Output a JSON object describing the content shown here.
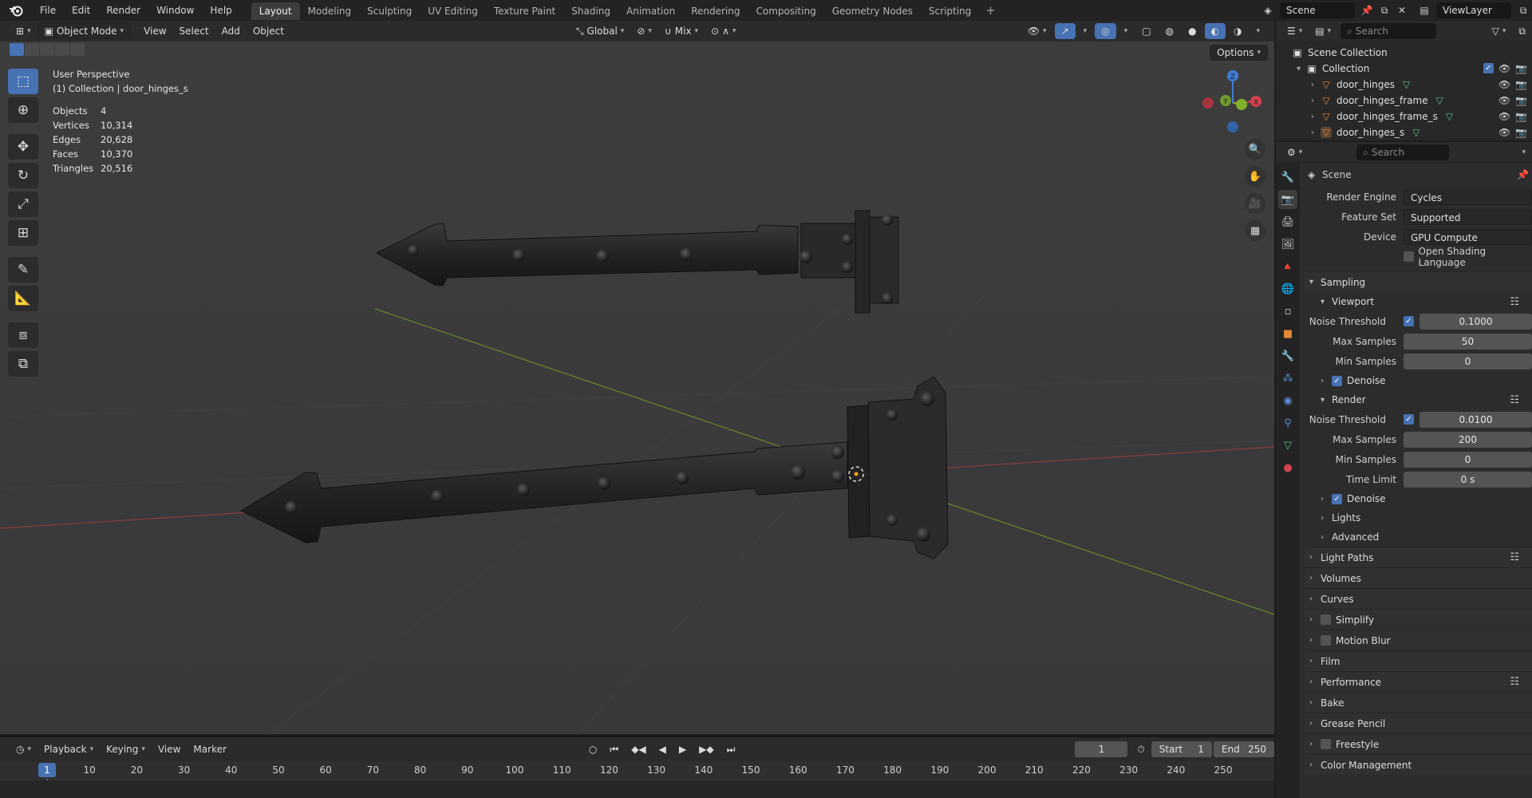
{
  "app": {
    "menu": [
      "File",
      "Edit",
      "Render",
      "Window",
      "Help"
    ]
  },
  "workspaces": {
    "tabs": [
      "Layout",
      "Modeling",
      "Sculpting",
      "UV Editing",
      "Texture Paint",
      "Shading",
      "Animation",
      "Rendering",
      "Compositing",
      "Geometry Nodes",
      "Scripting"
    ],
    "plus": "+"
  },
  "topright": {
    "scene": "Scene",
    "viewlayer": "ViewLayer"
  },
  "viewport": {
    "mode": "Object Mode",
    "menus": [
      "View",
      "Select",
      "Add",
      "Object"
    ],
    "transform_orientation": "Global",
    "snap_mode": "Mix",
    "options": "Options",
    "view_name": "User Perspective",
    "collection_line": "(1) Collection | door_hinges_s",
    "stats": [
      {
        "label": "Objects",
        "value": "4"
      },
      {
        "label": "Vertices",
        "value": "10,314"
      },
      {
        "label": "Edges",
        "value": "20,628"
      },
      {
        "label": "Faces",
        "value": "10,370"
      },
      {
        "label": "Triangles",
        "value": "20,516"
      }
    ],
    "gizmo": {
      "x": "X",
      "y": "Y",
      "z": "Z"
    }
  },
  "timeline": {
    "menus": [
      "Playback",
      "Keying",
      "View",
      "Marker"
    ],
    "current_frame": "1",
    "start_label": "Start",
    "start": "1",
    "end_label": "End",
    "end": "250",
    "ruler": [
      "1",
      "10",
      "20",
      "30",
      "40",
      "50",
      "60",
      "70",
      "80",
      "90",
      "100",
      "110",
      "120",
      "130",
      "140",
      "150",
      "160",
      "170",
      "180",
      "190",
      "200",
      "210",
      "220",
      "230",
      "240",
      "250"
    ]
  },
  "outliner": {
    "search_placeholder": "Search",
    "scene_collection": "Scene Collection",
    "collection": "Collection",
    "items": [
      "door_hinges",
      "door_hinges_frame",
      "door_hinges_frame_s",
      "door_hinges_s"
    ]
  },
  "properties": {
    "search_placeholder": "Search",
    "context": "Scene",
    "render_engine_label": "Render Engine",
    "render_engine": "Cycles",
    "feature_set_label": "Feature Set",
    "feature_set": "Supported",
    "device_label": "Device",
    "device": "GPU Compute",
    "osl_label": "Open Shading Language",
    "sampling": "Sampling",
    "viewport": "Viewport",
    "vp_noise_label": "Noise Threshold",
    "vp_noise": "0.1000",
    "vp_max_label": "Max Samples",
    "vp_max": "50",
    "vp_min_label": "Min Samples",
    "vp_min": "0",
    "denoise": "Denoise",
    "render": "Render",
    "r_noise_label": "Noise Threshold",
    "r_noise": "0.0100",
    "r_max_label": "Max Samples",
    "r_max": "200",
    "r_min_label": "Min Samples",
    "r_min": "0",
    "time_limit_label": "Time Limit",
    "time_limit": "0 s",
    "denoise2": "Denoise",
    "lights": "Lights",
    "advanced": "Advanced",
    "sections": [
      "Light Paths",
      "Volumes",
      "Curves",
      "Simplify",
      "Motion Blur",
      "Film",
      "Performance",
      "Bake",
      "Grease Pencil",
      "Freestyle",
      "Color Management"
    ]
  },
  "colors": {
    "accent": "#4772b3",
    "x_axis": "#d2424f",
    "y_axis": "#7fb22a",
    "z_axis": "#3f7cd6"
  }
}
